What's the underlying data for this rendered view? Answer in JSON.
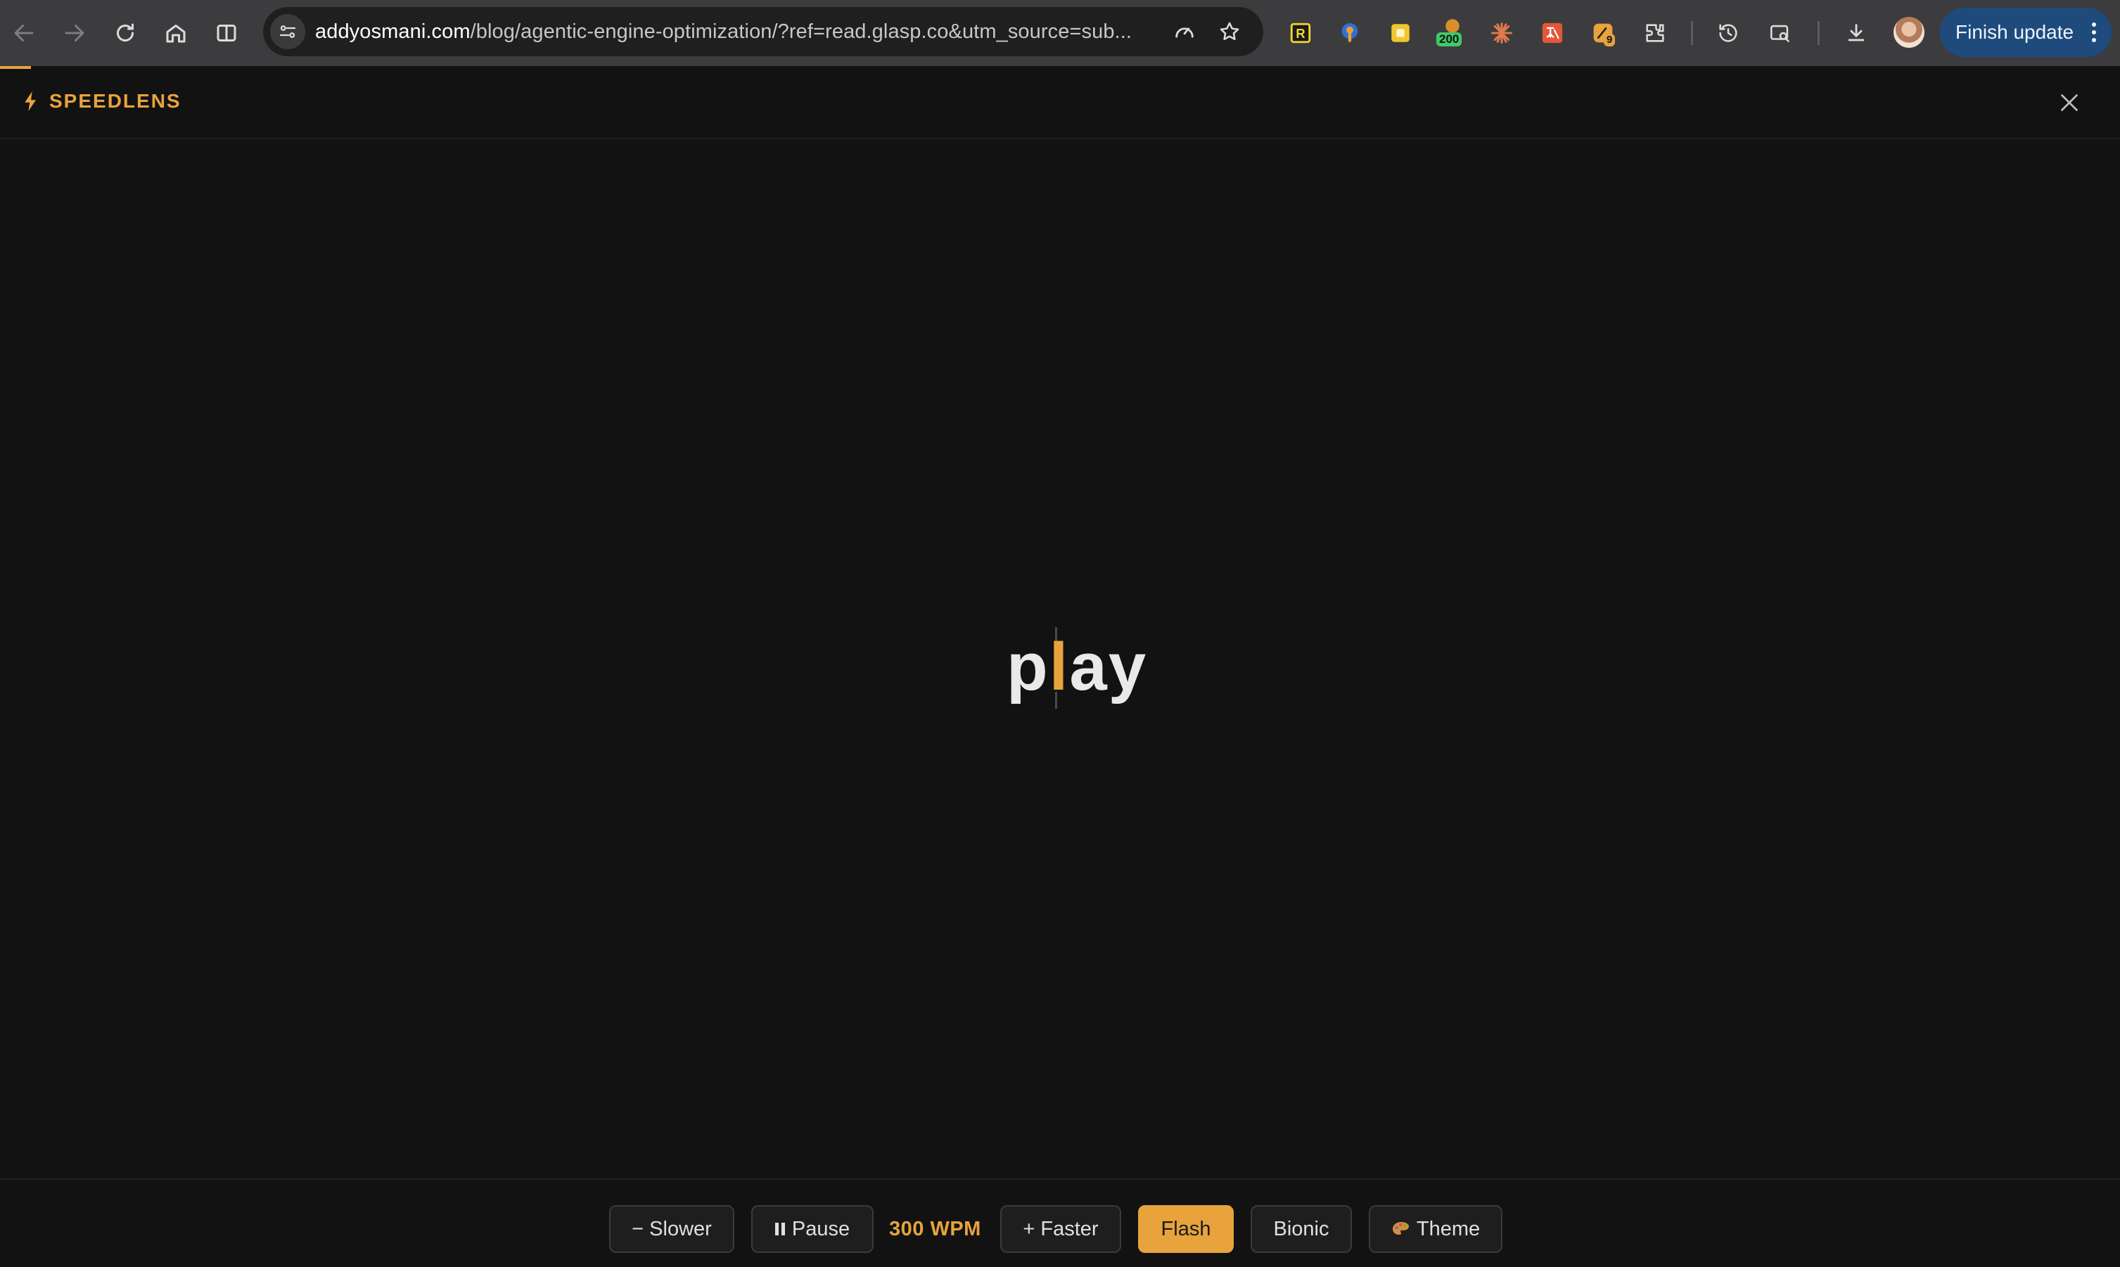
{
  "browser": {
    "url": "addyosmani.com/blog/agentic-engine-optimization/?ref=read.glasp.co&utm_source=sub...",
    "url_domain": "addyosmani.com",
    "url_path": "/blog/agentic-engine-optimization/?ref=read.glasp.co&utm_source=sub...",
    "update_button_label": "Finish update",
    "extension_badges": {
      "counter_200": "200",
      "counter_9": "9"
    },
    "icons": [
      "back-icon",
      "forward-icon",
      "reload-icon",
      "home-icon",
      "split-view-icon",
      "site-info-icon",
      "performance-icon",
      "bookmark-star-icon",
      "extensions-icon",
      "history-icon",
      "tab-search-icon",
      "downloads-icon",
      "profile-avatar"
    ]
  },
  "speedlens": {
    "brand": "SPEEDLENS",
    "current_word": {
      "before": "p",
      "focus": "l",
      "after": "ay"
    },
    "controls": {
      "slower_label": "− Slower",
      "pause_label": "Pause",
      "wpm_label": "300 WPM",
      "faster_label": "+ Faster",
      "flash_label": "Flash",
      "bionic_label": "Bionic",
      "theme_label": "Theme"
    },
    "active_mode": "Flash"
  },
  "colors": {
    "accent": "#e8a33d",
    "background": "#121212",
    "toolbar": "#3c3c3e",
    "update_button": "#1e4b7c",
    "text": "#e9e9e9"
  }
}
